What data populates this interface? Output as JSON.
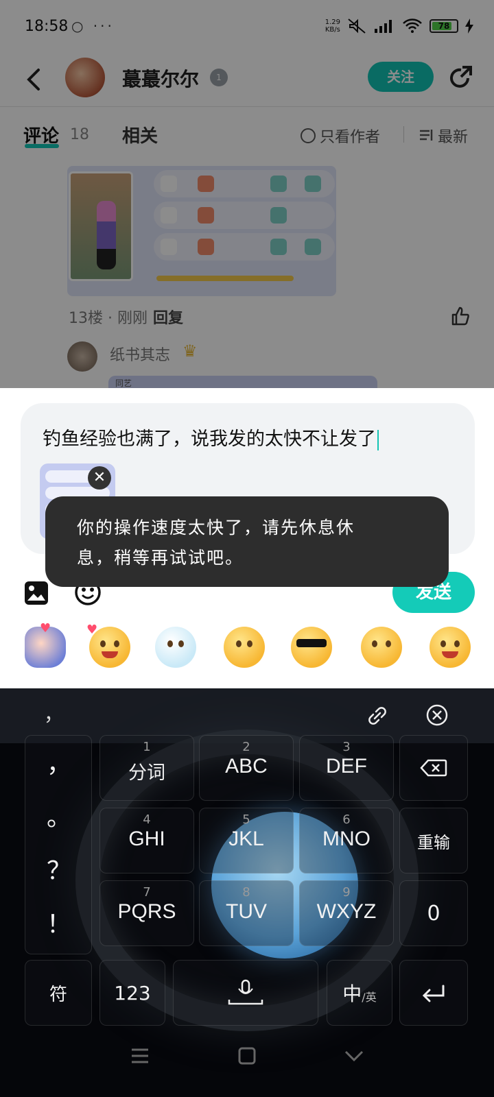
{
  "status_bar": {
    "time": "18:58",
    "dots": "○ ···",
    "net_speed_value": "1.29",
    "net_speed_unit": "KB/s",
    "battery": "78"
  },
  "header": {
    "author_name": "蕞蕞尔尔",
    "level": "1",
    "follow_label": "关注"
  },
  "tabs": {
    "comment_label": "评论",
    "comment_count": "18",
    "related_label": "相关",
    "only_author_label": "只看作者",
    "sort_label": "最新"
  },
  "post": {
    "floor_info": "13楼 · 刚刚",
    "reply_label": "回复"
  },
  "sub_comment": {
    "user_name": "纸书其志",
    "card_label": "同艺"
  },
  "reply_box": {
    "input_text": "钓鱼经验也满了，说我发的太快不让发了",
    "send_label": "发送"
  },
  "toast": {
    "line1": "你的操作速度太快了，请先休息休",
    "line2": "息，稍等再试试吧。"
  },
  "stickers": [
    "finger-heart-sticker",
    "love-smile-sticker",
    "crying-seal-sticker",
    "shy-smile-sticker",
    "sunglasses-sticker",
    "smirk-sticker",
    "grin-sticker"
  ],
  "keyboard": {
    "candidate_comma": "，",
    "punct": [
      "，",
      "。",
      "？",
      "！"
    ],
    "keys": [
      {
        "num": "1",
        "label": "分词"
      },
      {
        "num": "2",
        "label": "ABC"
      },
      {
        "num": "3",
        "label": "DEF"
      },
      {
        "num": "4",
        "label": "GHI"
      },
      {
        "num": "5",
        "label": "JKL"
      },
      {
        "num": "6",
        "label": "MNO"
      },
      {
        "num": "7",
        "label": "PQRS"
      },
      {
        "num": "8",
        "label": "TUV"
      },
      {
        "num": "9",
        "label": "WXYZ"
      }
    ],
    "reinput_label": "重输",
    "zero_label": "0",
    "symbols_label": "符",
    "numbers_label": "123",
    "lang_main": "中",
    "lang_sub": "/英"
  },
  "colors": {
    "accent": "#14cbb8",
    "toast_bg": "#2d2d2d",
    "keyboard_bg": "#05060a"
  }
}
